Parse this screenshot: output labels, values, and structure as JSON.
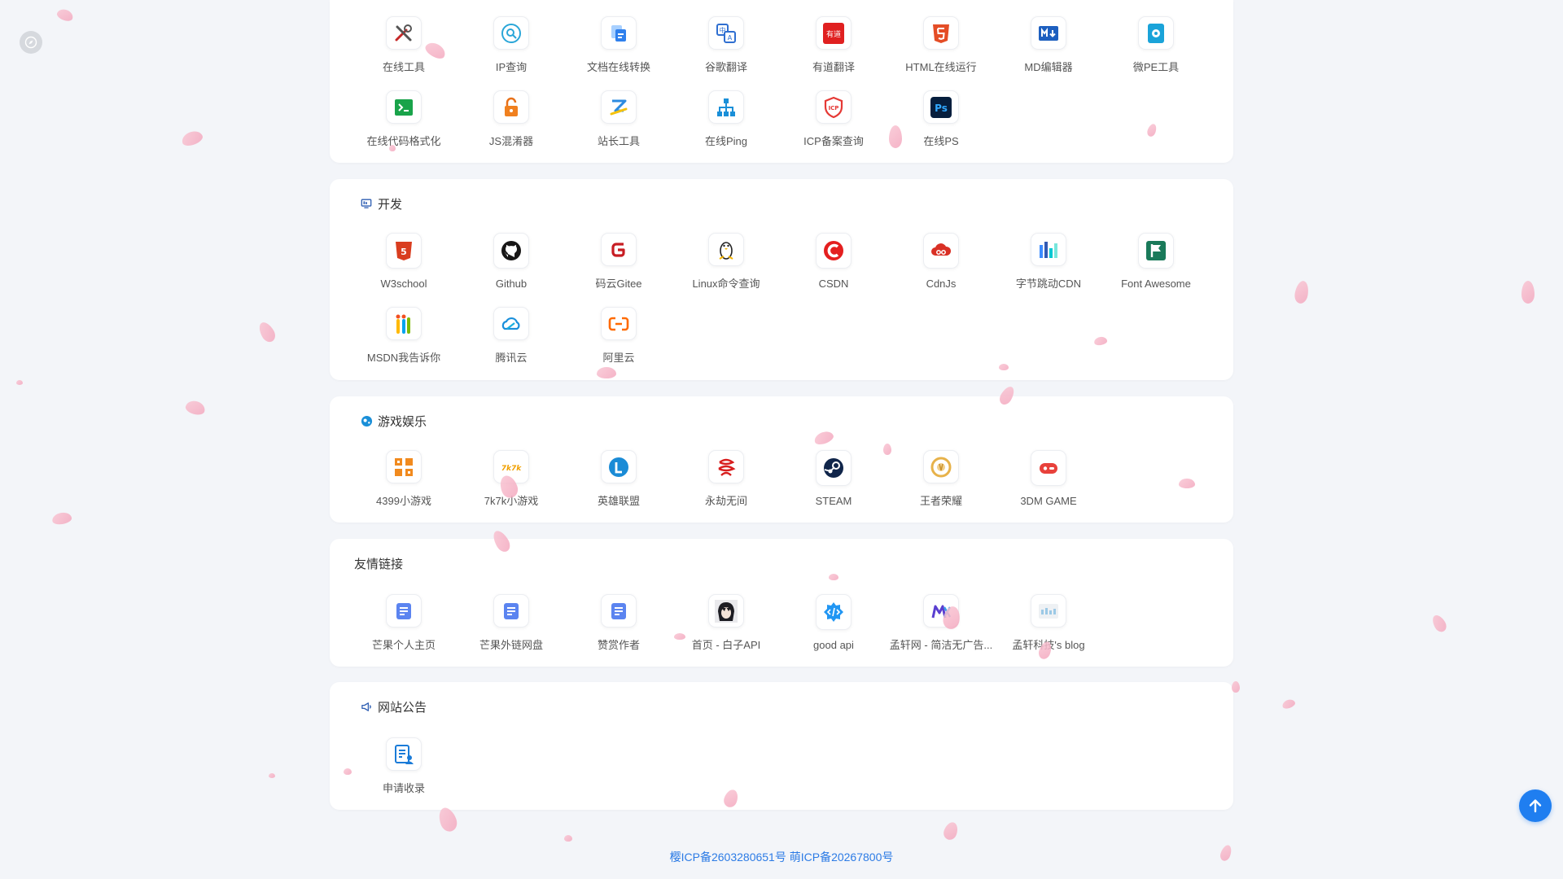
{
  "colors": {
    "accent": "#1f7ef0",
    "footer_link": "#2c7be5",
    "card_bg": "#ffffff",
    "page_bg": "#f3f5f9"
  },
  "sections": [
    {
      "title": "",
      "header_icon": "",
      "items": [
        {
          "label": "在线工具",
          "icon": "tools-icon"
        },
        {
          "label": "IP查询",
          "icon": "ip-search-icon"
        },
        {
          "label": "文档在线转换",
          "icon": "document-convert-icon"
        },
        {
          "label": "谷歌翻译",
          "icon": "google-translate-icon"
        },
        {
          "label": "有道翻译",
          "icon": "youdao-icon"
        },
        {
          "label": "HTML在线运行",
          "icon": "html5-icon"
        },
        {
          "label": "MD编辑器",
          "icon": "markdown-icon"
        },
        {
          "label": "微PE工具",
          "icon": "wepe-icon"
        },
        {
          "label": "在线代码格式化",
          "icon": "terminal-icon"
        },
        {
          "label": "JS混淆器",
          "icon": "lock-icon"
        },
        {
          "label": "站长工具",
          "icon": "webmaster-icon"
        },
        {
          "label": "在线Ping",
          "icon": "network-icon"
        },
        {
          "label": "ICP备案查询",
          "icon": "icp-shield-icon"
        },
        {
          "label": "在线PS",
          "icon": "photoshop-icon"
        }
      ]
    },
    {
      "title": "开发",
      "header_icon": "monitor-icon",
      "items": [
        {
          "label": "W3school",
          "icon": "w3school-icon"
        },
        {
          "label": "Github",
          "icon": "github-icon"
        },
        {
          "label": "码云Gitee",
          "icon": "gitee-icon"
        },
        {
          "label": "Linux命令查询",
          "icon": "linux-penguin-icon"
        },
        {
          "label": "CSDN",
          "icon": "csdn-icon"
        },
        {
          "label": "CdnJs",
          "icon": "cdnjs-icon"
        },
        {
          "label": "字节跳动CDN",
          "icon": "bytedance-icon"
        },
        {
          "label": "Font Awesome",
          "icon": "font-awesome-flag-icon"
        },
        {
          "label": "MSDN我告诉你",
          "icon": "msdn-icon"
        },
        {
          "label": "腾讯云",
          "icon": "tencent-cloud-icon"
        },
        {
          "label": "阿里云",
          "icon": "aliyun-icon"
        }
      ]
    },
    {
      "title": "游戏娱乐",
      "header_icon": "gamepad-icon",
      "items": [
        {
          "label": "4399小游戏",
          "icon": "4399-icon"
        },
        {
          "label": "7k7k小游戏",
          "icon": "7k7k-icon"
        },
        {
          "label": "英雄联盟",
          "icon": "lol-icon"
        },
        {
          "label": "永劫无间",
          "icon": "naraka-icon"
        },
        {
          "label": "STEAM",
          "icon": "steam-icon"
        },
        {
          "label": "王者荣耀",
          "icon": "honor-of-kings-icon"
        },
        {
          "label": "3DM GAME",
          "icon": "3dm-icon"
        }
      ]
    },
    {
      "title": "友情链接",
      "header_icon": "",
      "items": [
        {
          "label": "芒果个人主页",
          "icon": "link-doc-icon"
        },
        {
          "label": "芒果外链网盘",
          "icon": "link-doc-icon"
        },
        {
          "label": "赞赏作者",
          "icon": "link-doc-icon"
        },
        {
          "label": "首页 - 白子API",
          "icon": "anime-avatar-icon"
        },
        {
          "label": "good api",
          "icon": "code-badge-icon"
        },
        {
          "label": "孟轩网 - 简洁无广告...",
          "icon": "mx-logo-icon"
        },
        {
          "label": "孟轩科技's blog",
          "icon": "blog-thumb-icon"
        }
      ]
    },
    {
      "title": "网站公告",
      "header_icon": "megaphone-icon",
      "items": [
        {
          "label": "申请收录",
          "icon": "apply-form-icon"
        }
      ]
    }
  ],
  "footer": {
    "text": "樱ICP备2603280651号 萌ICP备20267800号"
  },
  "scroll_top": {
    "icon": "arrow-up-icon"
  }
}
